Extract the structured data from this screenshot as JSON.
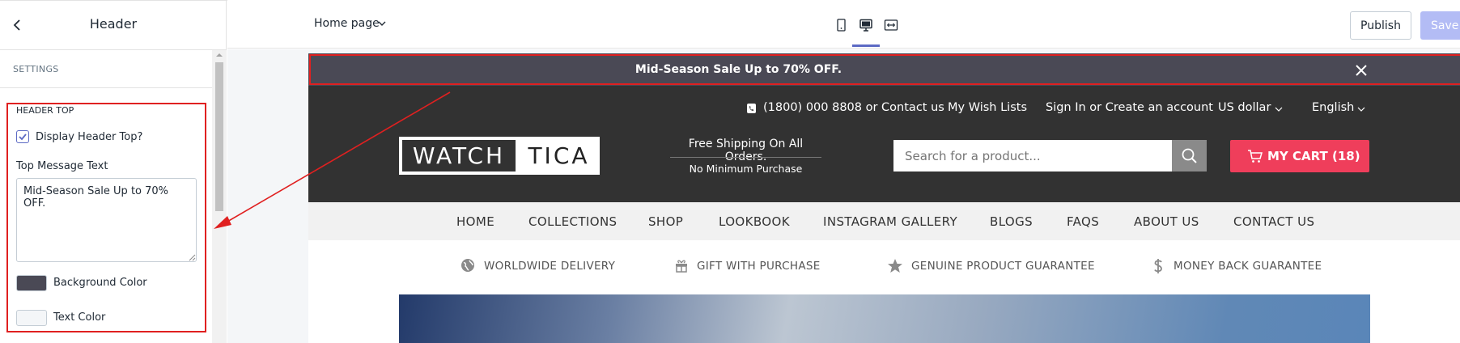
{
  "panel": {
    "title": "Header",
    "section_label": "SETTINGS",
    "group_label": "HEADER TOP",
    "display_toggle_label": "Display Header Top?",
    "display_toggle_checked": true,
    "message_label": "Top Message Text",
    "message_value": "Mid-Season Sale Up to 70% OFF.",
    "bg_color_label": "Background Color",
    "bg_color_value": "#4a4955",
    "text_color_label": "Text Color",
    "text_color_value": "#f4f6f8"
  },
  "toolbar": {
    "page_select": "Home page",
    "device_icons": [
      "mobile-icon",
      "desktop-icon",
      "fullscreen-icon"
    ],
    "active_device": "desktop-icon",
    "publish_label": "Publish",
    "save_label": "Save"
  },
  "preview": {
    "announcement": "Mid-Season Sale Up to 70% OFF.",
    "phone": "(1800) 000 8808 or Contact us",
    "wishlist": "My Wish Lists",
    "account": "Sign In or Create an account",
    "currency": "US dollar",
    "language": "English",
    "logo_left": "WATCH",
    "logo_right": "TICA",
    "shipping_title": "Free Shipping On All Orders.",
    "shipping_sub": "No Minimum Purchase",
    "search_placeholder": "Search for a product...",
    "cart_label": "MY CART (18)",
    "nav": [
      "HOME",
      "COLLECTIONS",
      "SHOP",
      "LOOKBOOK",
      "INSTAGRAM GALLERY",
      "BLOGS",
      "FAQS",
      "ABOUT US",
      "CONTACT US"
    ],
    "features": [
      "WORLDWIDE DELIVERY",
      "GIFT WITH PURCHASE",
      "GENUINE PRODUCT GUARANTEE",
      "MONEY BACK GUARANTEE"
    ]
  },
  "colors": {
    "accent": "#5c6ac4",
    "highlight": "#e02020",
    "announcement_bg": "#4a4955",
    "header_bg": "#323232",
    "cart_bg": "#ef3e5b"
  }
}
